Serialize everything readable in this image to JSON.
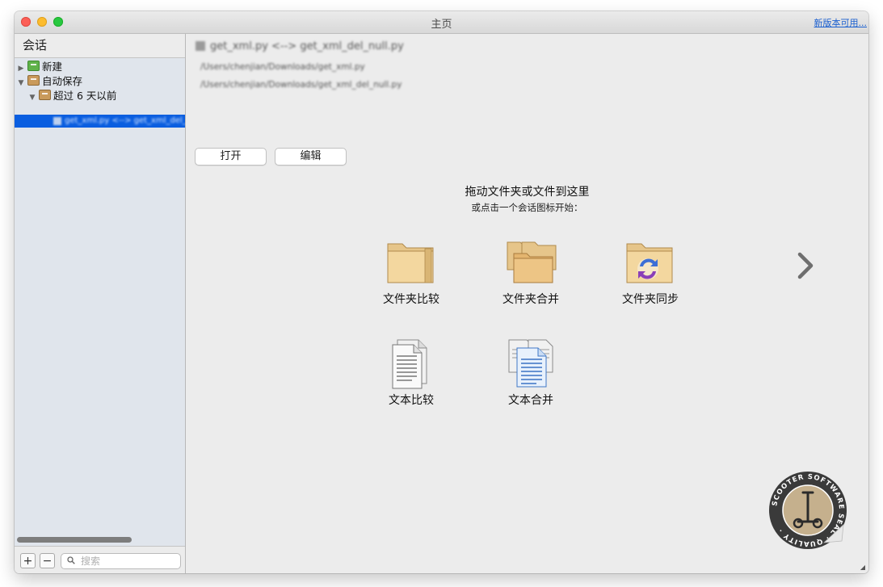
{
  "window": {
    "title": "主页",
    "update_link": "新版本可用..."
  },
  "sidebar": {
    "header": "会话",
    "tree": [
      {
        "label": "新建",
        "expanded": false,
        "icon": "green-folder-icon"
      },
      {
        "label": "自动保存",
        "expanded": true,
        "icon": "brown-folder-icon"
      },
      {
        "label": "超过 6 天以前",
        "expanded": true,
        "icon": "brown-folder-icon"
      }
    ],
    "selected_item": "get_xml.py <--> get_xml_del_null.py",
    "footer": {
      "add": "+",
      "remove": "−",
      "search_placeholder": "搜索"
    }
  },
  "session": {
    "name": "get_xml.py <--> get_xml_del_null.py",
    "path_left": "/Users/chenjian/Downloads/get_xml.py",
    "path_right": "/Users/chenjian/Downloads/get_xml_del_null.py",
    "open_button": "打开",
    "edit_button": "编辑"
  },
  "drop_zone": {
    "title": "拖动文件夹或文件到这里",
    "subtitle": "或点击一个会话图标开始：",
    "tiles": [
      {
        "label": "文件夹比较",
        "icon": "folder-compare-icon"
      },
      {
        "label": "文件夹合并",
        "icon": "folder-merge-icon"
      },
      {
        "label": "文件夹同步",
        "icon": "folder-sync-icon"
      },
      {
        "label": "文本比较",
        "icon": "text-compare-icon"
      },
      {
        "label": "文本合并",
        "icon": "text-merge-icon"
      }
    ]
  },
  "seal": {
    "text": "SCOOTER SOFTWARE SEAL · QUALITY"
  }
}
